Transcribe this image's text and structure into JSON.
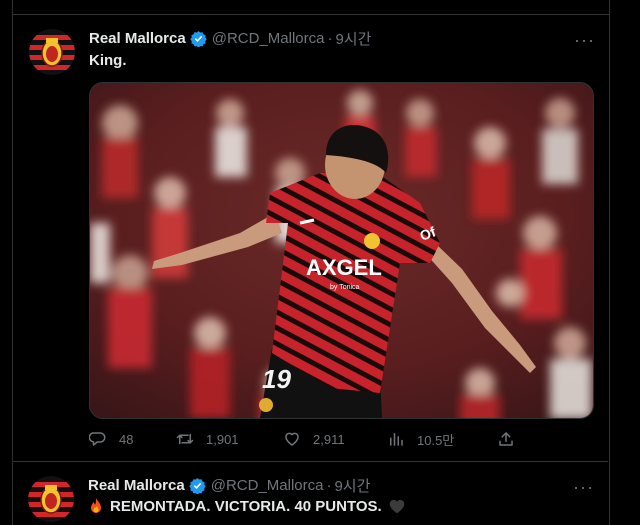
{
  "tweets": [
    {
      "author": "Real Mallorca",
      "handle": "@RCD_Mallorca",
      "separator": "·",
      "time": "9시간",
      "more": "···",
      "text": "King.",
      "media": {
        "jersey_number": "19",
        "sponsor_name": "AXGEL",
        "sponsor_sub": "by Tonica",
        "sleeve_text": "Of"
      },
      "actions": {
        "replies": "48",
        "retweets": "1,901",
        "likes": "2,911",
        "views": "10.5만"
      }
    },
    {
      "author": "Real Mallorca",
      "handle": "@RCD_Mallorca",
      "separator": "·",
      "time": "9시간",
      "more": "···",
      "text": "REMONTADA. VICTORIA. 40 PUNTOS."
    }
  ],
  "colors": {
    "background": "#000000",
    "text_primary": "#e7e9ea",
    "text_secondary": "#71767b",
    "verified": "#1d9bf0",
    "border": "#2f3336",
    "mallorca_red": "#d2262a"
  },
  "icons": {
    "reply": "speech-bubble-icon",
    "retweet": "retweet-arrows-icon",
    "like": "heart-icon",
    "views": "bar-chart-icon",
    "share": "share-upload-icon",
    "verified": "verified-badge-icon",
    "fire_emoji": "fire-emoji",
    "heart_emoji": "black-heart-emoji"
  }
}
